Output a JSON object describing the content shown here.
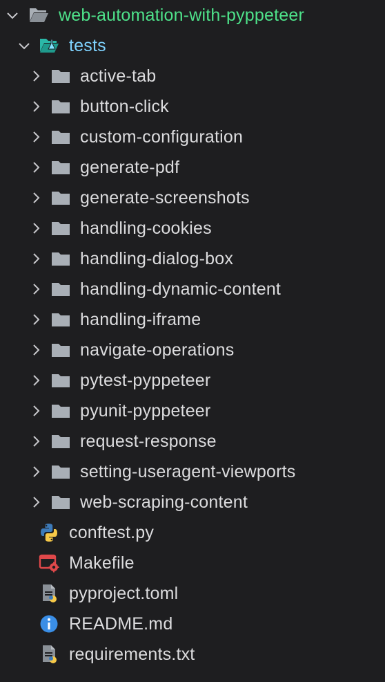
{
  "explorer": {
    "root": {
      "label": "web-automation-with-pyppeteer",
      "icon": "folder-open-icon",
      "expanded": true
    },
    "tests": {
      "label": "tests",
      "icon": "test-folder-open-icon",
      "expanded": true
    },
    "test_folders": [
      {
        "label": "active-tab",
        "icon": "folder-icon"
      },
      {
        "label": "button-click",
        "icon": "folder-icon"
      },
      {
        "label": "custom-configuration",
        "icon": "folder-icon"
      },
      {
        "label": "generate-pdf",
        "icon": "folder-icon"
      },
      {
        "label": "generate-screenshots",
        "icon": "folder-icon"
      },
      {
        "label": "handling-cookies",
        "icon": "folder-icon"
      },
      {
        "label": "handling-dialog-box",
        "icon": "folder-icon"
      },
      {
        "label": "handling-dynamic-content",
        "icon": "folder-icon"
      },
      {
        "label": "handling-iframe",
        "icon": "folder-icon"
      },
      {
        "label": "navigate-operations",
        "icon": "folder-icon"
      },
      {
        "label": "pytest-pyppeteer",
        "icon": "folder-icon"
      },
      {
        "label": "pyunit-pyppeteer",
        "icon": "folder-icon"
      },
      {
        "label": "request-response",
        "icon": "folder-icon"
      },
      {
        "label": "setting-useragent-viewports",
        "icon": "folder-icon"
      },
      {
        "label": "web-scraping-content",
        "icon": "folder-icon"
      }
    ],
    "files": [
      {
        "label": "conftest.py",
        "icon": "python-file-icon"
      },
      {
        "label": "Makefile",
        "icon": "makefile-icon"
      },
      {
        "label": "pyproject.toml",
        "icon": "toml-file-icon"
      },
      {
        "label": "README.md",
        "icon": "info-icon"
      },
      {
        "label": "requirements.txt",
        "icon": "requirements-file-icon"
      }
    ]
  },
  "colors": {
    "background": "#1e1e20",
    "root_label": "#4ee28a",
    "tests_label": "#7fd3ff",
    "folder": "#a9afb6",
    "chevron": "#c8c8cc",
    "python_blue": "#3d7ab8",
    "python_yellow": "#f7c948",
    "makefile_red": "#e0484a",
    "info_blue": "#3a8ee6"
  }
}
